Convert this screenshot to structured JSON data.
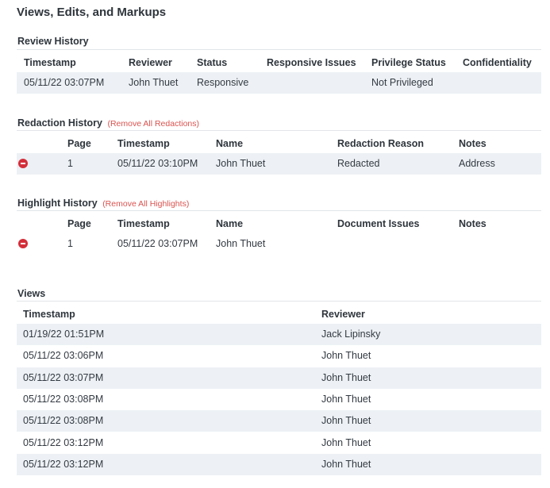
{
  "page_title": "Views, Edits, and Markups",
  "review_history": {
    "title": "Review History",
    "columns": [
      "Timestamp",
      "Reviewer",
      "Status",
      "Responsive Issues",
      "Privilege Status",
      "Confidentiality"
    ],
    "rows": [
      [
        "05/11/22 03:07PM",
        "John Thuet",
        "Responsive",
        "",
        "Not Privileged",
        ""
      ]
    ]
  },
  "redaction_history": {
    "title": "Redaction History",
    "action_link": "(Remove All Redactions)",
    "columns": [
      "Page",
      "Timestamp",
      "Name",
      "Redaction Reason",
      "Notes"
    ],
    "rows": [
      [
        "1",
        "05/11/22 03:10PM",
        "John Thuet",
        "Redacted",
        "Address"
      ]
    ]
  },
  "highlight_history": {
    "title": "Highlight History",
    "action_link": "(Remove All Highlights)",
    "columns": [
      "Page",
      "Timestamp",
      "Name",
      "Document Issues",
      "Notes"
    ],
    "rows": [
      [
        "1",
        "05/11/22 03:07PM",
        "John Thuet",
        "",
        ""
      ]
    ]
  },
  "views": {
    "title": "Views",
    "columns": [
      "Timestamp",
      "Reviewer"
    ],
    "rows": [
      [
        "01/19/22 01:51PM",
        "Jack Lipinsky"
      ],
      [
        "05/11/22 03:06PM",
        "John Thuet"
      ],
      [
        "05/11/22 03:07PM",
        "John Thuet"
      ],
      [
        "05/11/22 03:08PM",
        "John Thuet"
      ],
      [
        "05/11/22 03:08PM",
        "John Thuet"
      ],
      [
        "05/11/22 03:12PM",
        "John Thuet"
      ],
      [
        "05/11/22 03:12PM",
        "John Thuet"
      ]
    ]
  },
  "icons": {
    "remove": "remove-circle-icon"
  },
  "colors": {
    "accent_link": "#d9534f",
    "remove_icon": "#d42e3a",
    "row_shade": "#edf1f5"
  }
}
